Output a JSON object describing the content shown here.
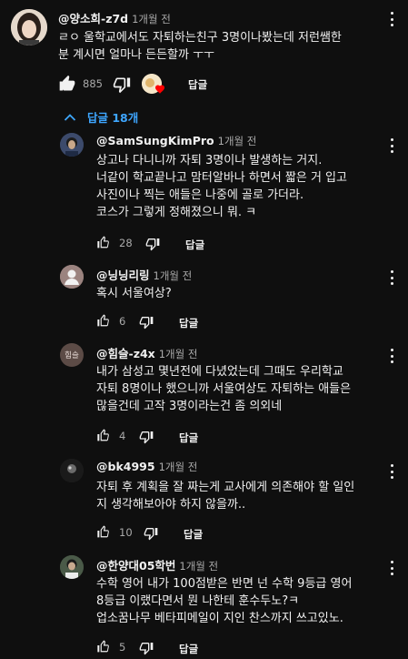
{
  "top_comment": {
    "handle": "@양소희-z7d",
    "time": "1개월 전",
    "lines": [
      "ㄹㅇ 울학교에서도 자퇴하는친구 3명이나봤는데 저런쌤한",
      "분 계시면 얼마나 든든할까 ㅜㅜ"
    ],
    "likes": "885",
    "reply_label": "답글"
  },
  "replies_toggle": {
    "label": "답글 18개",
    "icon": "chevron-up-icon"
  },
  "replies": [
    {
      "handle": "@SamSungKimPro",
      "time": "1개월 전",
      "lines": [
        "상고나 다니니까 자퇴 3명이나 발생하는 거지.",
        "너같이 학교끝나고 맘터알바나 하면서 짧은 거 입고",
        "사진이나 찍는 애들은 나중에 골로 가더라.",
        "코스가 그렇게 정해졌으니 뭐. ㅋ"
      ],
      "likes": "28",
      "reply_label": "답글"
    },
    {
      "handle": "@닝닝리링",
      "time": "1개월 전",
      "lines": [
        "혹시 서울여상?"
      ],
      "likes": "6",
      "reply_label": "답글"
    },
    {
      "handle": "@힘슬-z4x",
      "time": "1개월 전",
      "avatar_text": "힘슬",
      "lines": [
        "내가 삼성고 몇년전에 다녔었는데 그때도 우리학교",
        "자퇴 8명이나 했으니까 서울여상도 자퇴하는 애들은",
        "많을건데 고작 3명이라는건 좀 의외네"
      ],
      "likes": "4",
      "reply_label": "답글"
    },
    {
      "handle": "@bk4995",
      "time": "1개월 전",
      "lines": [
        "자퇴 후 계획을 잘 짜는게 교사에게 의존해야 할 일인",
        "지 생각해보아야 하지 않을까.."
      ],
      "likes": "10",
      "reply_label": "답글"
    },
    {
      "handle": "@한양대05학번",
      "time": "1개월 전",
      "lines": [
        "수학 영어 내가 100점받은 반면 넌 수학 9등급 영어",
        "8등급 이랬다면서 뭔 나한테 훈수두노?ㅋ",
        "업소꿈나무 베타피메일이 지인 찬스까지 쓰고있노."
      ],
      "likes": "5",
      "reply_label": "답글"
    }
  ],
  "colors": {
    "background": "#0f0f0f",
    "text": "#f1f1f1",
    "secondary_text": "#aaaaaa",
    "link_blue": "#3ea6ff",
    "heart_red": "#ff0000"
  }
}
